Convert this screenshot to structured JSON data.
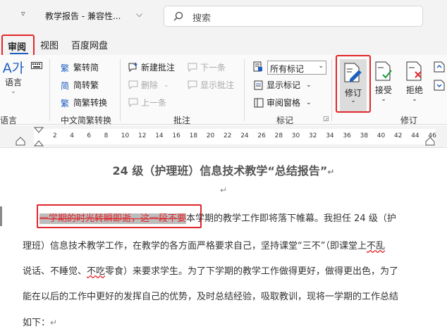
{
  "titlebar": {
    "qat_symbol": "▿",
    "doc_title": "教学报告 - 兼容性...",
    "title_dropdown": "⌵",
    "search_placeholder": "搜索"
  },
  "tabs": [
    {
      "label": "审阅",
      "active": true
    },
    {
      "label": "视图"
    },
    {
      "label": "百度网盘"
    }
  ],
  "ribbon": {
    "language": {
      "big_label": "语言",
      "big_glyph": "A가",
      "group_label": "语言"
    },
    "chinese_conv": {
      "items": [
        "繁转简",
        "简转繁",
        "简繁转换"
      ],
      "group_label": "中文简繁转换"
    },
    "comments": {
      "new": "新建批注",
      "delete": "删除",
      "previous": "上一条",
      "next": "下一条",
      "show": "显示批注",
      "group_label": "批注"
    },
    "tracking": {
      "markup_select": "所有标记",
      "show_markup": "显示标记",
      "review_pane": "审阅窗格",
      "group_label": "标记"
    },
    "changes": {
      "track": "修订",
      "accept": "接受",
      "reject": "拒绝",
      "group_label": "修订"
    }
  },
  "ruler": {
    "ticks": [
      "2",
      "4",
      "6",
      "8",
      "10",
      "12",
      "14",
      "16",
      "18",
      "20",
      "22",
      "24",
      "26",
      "28",
      "30",
      "32",
      "34",
      "36",
      "38",
      "40",
      "42",
      "44",
      "46"
    ]
  },
  "document": {
    "title": "24 级（护理班）信息技术教学“总结报告”",
    "para_mark": "↵",
    "deleted_text": "一学期的时光转瞬即逝，这一段不要",
    "line1_rest": "本学期的教学工作即将落下帷幕。我担任 24 级（护",
    "line2a": "理班）信息技术教学工作，在教学的各方面严格要求自己，坚持课堂“三不”（即课堂上",
    "line2_wavy": "不乱",
    "line3a": "说话、不睡觉、",
    "line3_wavy": "不吃",
    "line3b": "零食）来要求学生。为了下学期的教学工作做得更好，做得更出色，为了",
    "line4": "能在以后的工作中更好的发挥自己的优势，及时总结经验，吸取教训，现将一学期的工作总结",
    "line5": "如下："
  }
}
